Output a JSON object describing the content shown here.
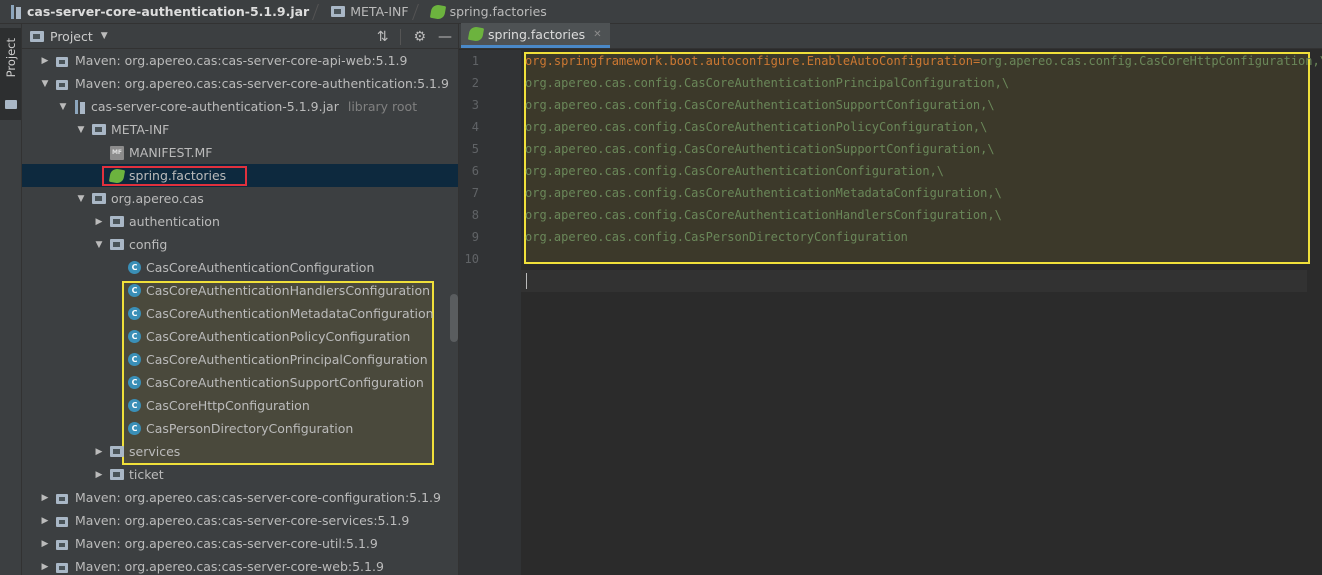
{
  "breadcrumb": {
    "items": [
      {
        "label": "cas-server-core-authentication-5.1.9.jar"
      },
      {
        "label": "META-INF"
      },
      {
        "label": "spring.factories"
      }
    ]
  },
  "toolstrip": {
    "label": "Project"
  },
  "project_panel": {
    "title": "Project",
    "dropdown": "▼",
    "tools": {
      "collapse": "⇅",
      "settings": "⚙",
      "hide": "—"
    }
  },
  "tree": [
    {
      "label": "Maven: org.apereo.cas:cas-server-core-api-web:5.1.9",
      "arrow": "▶"
    },
    {
      "label": "Maven: org.apereo.cas:cas-server-core-authentication:5.1.9",
      "arrow": "▼"
    },
    {
      "label": "cas-server-core-authentication-5.1.9.jar",
      "arrow": "▼",
      "extra": "library root"
    },
    {
      "label": "META-INF",
      "arrow": "▼"
    },
    {
      "label": "MANIFEST.MF",
      "arrow": "",
      "badge": "MF"
    },
    {
      "label": "spring.factories",
      "arrow": ""
    },
    {
      "label": "org.apereo.cas",
      "arrow": "▼"
    },
    {
      "label": "authentication",
      "arrow": "▶"
    },
    {
      "label": "config",
      "arrow": "▼"
    },
    {
      "label": "CasCoreAuthenticationConfiguration",
      "arrow": "",
      "badge": "C"
    },
    {
      "label": "CasCoreAuthenticationHandlersConfiguration",
      "arrow": "",
      "badge": "C"
    },
    {
      "label": "CasCoreAuthenticationMetadataConfiguration",
      "arrow": "",
      "badge": "C"
    },
    {
      "label": "CasCoreAuthenticationPolicyConfiguration",
      "arrow": "",
      "badge": "C"
    },
    {
      "label": "CasCoreAuthenticationPrincipalConfiguration",
      "arrow": "",
      "badge": "C"
    },
    {
      "label": "CasCoreAuthenticationSupportConfiguration",
      "arrow": "",
      "badge": "C"
    },
    {
      "label": "CasCoreHttpConfiguration",
      "arrow": "",
      "badge": "C"
    },
    {
      "label": "CasPersonDirectoryConfiguration",
      "arrow": "",
      "badge": "C"
    },
    {
      "label": "services",
      "arrow": "▶"
    },
    {
      "label": "ticket",
      "arrow": "▶"
    },
    {
      "label": "Maven: org.apereo.cas:cas-server-core-configuration:5.1.9",
      "arrow": "▶"
    },
    {
      "label": "Maven: org.apereo.cas:cas-server-core-services:5.1.9",
      "arrow": "▶"
    },
    {
      "label": "Maven: org.apereo.cas:cas-server-core-util:5.1.9",
      "arrow": "▶"
    },
    {
      "label": "Maven: org.apereo.cas:cas-server-core-web:5.1.9",
      "arrow": "▶"
    }
  ],
  "editor": {
    "tab": {
      "label": "spring.factories",
      "close": "✕"
    },
    "line_numbers": [
      "1",
      "2",
      "3",
      "4",
      "5",
      "6",
      "7",
      "8",
      "9",
      "10"
    ],
    "lines": [
      {
        "key": "org.springframework.boot.autoconfigure.EnableAutoConfiguration",
        "eq": "=",
        "val": "org.apereo.cas.config.CasCoreHttpConfiguration,\\"
      },
      {
        "val": "org.apereo.cas.config.CasCoreAuthenticationPrincipalConfiguration,\\"
      },
      {
        "val": "org.apereo.cas.config.CasCoreAuthenticationSupportConfiguration,\\"
      },
      {
        "val": "org.apereo.cas.config.CasCoreAuthenticationPolicyConfiguration,\\"
      },
      {
        "val": "org.apereo.cas.config.CasCoreAuthenticationSupportConfiguration,\\"
      },
      {
        "val": "org.apereo.cas.config.CasCoreAuthenticationConfiguration,\\"
      },
      {
        "val": "org.apereo.cas.config.CasCoreAuthenticationMetadataConfiguration,\\"
      },
      {
        "val": "org.apereo.cas.config.CasCoreAuthenticationHandlersConfiguration,\\"
      },
      {
        "val": "org.apereo.cas.config.CasPersonDirectoryConfiguration"
      },
      {
        "val": ""
      }
    ]
  },
  "colors": {
    "selection": "#0d293e",
    "highlight_red": "#e0313d",
    "highlight_yellow": "#f0e03a",
    "property_key": "#cc7832",
    "property_value": "#6a8759"
  }
}
